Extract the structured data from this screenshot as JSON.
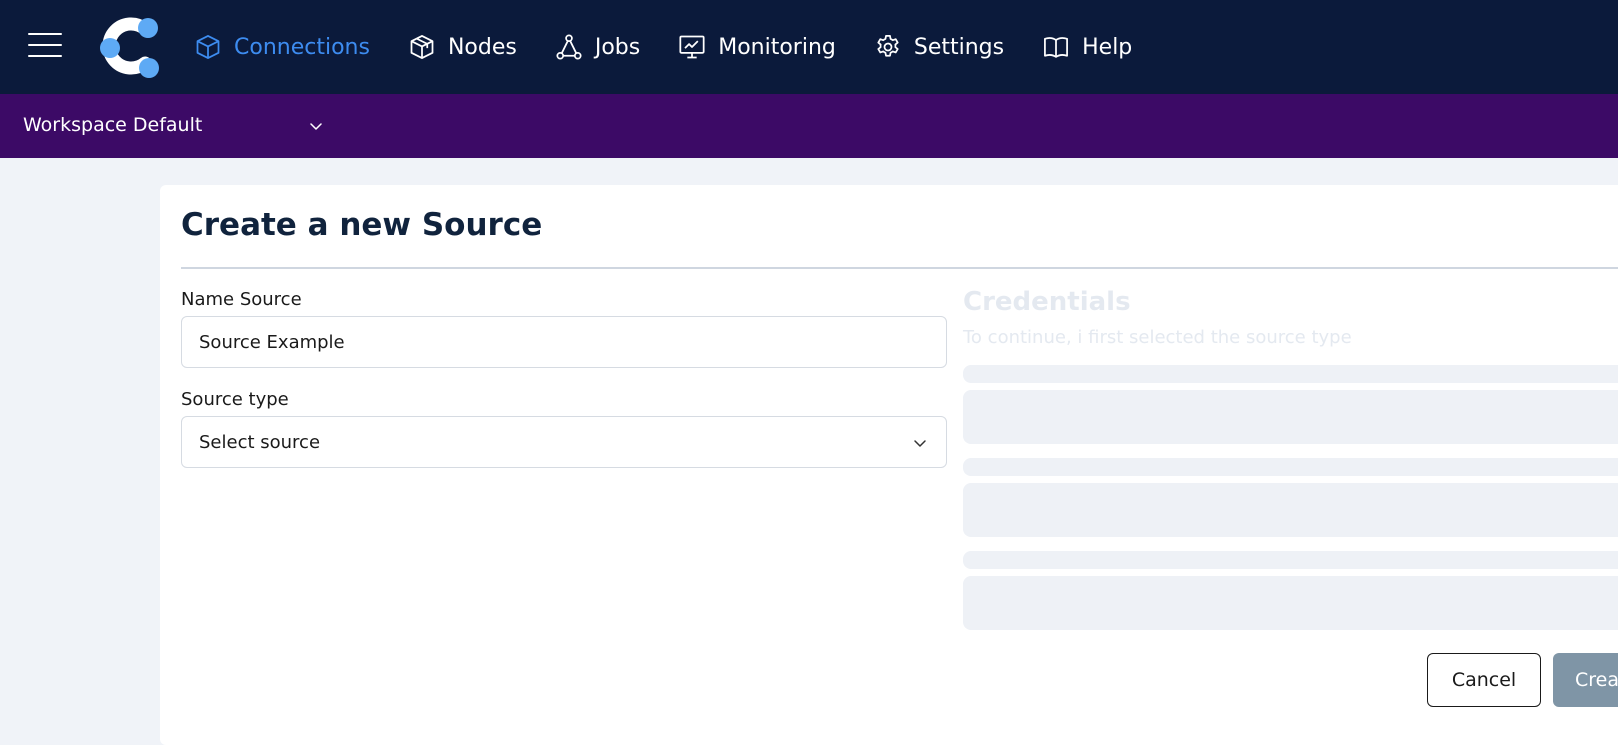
{
  "topbar": {
    "menu_icon": "hamburger-menu-icon",
    "logo_icon": "app-logo-icon",
    "nav": [
      {
        "label": "Connections",
        "icon": "cube-icon",
        "active": true
      },
      {
        "label": "Nodes",
        "icon": "boxes-icon",
        "active": false
      },
      {
        "label": "Jobs",
        "icon": "nodes-graph-icon",
        "active": false
      },
      {
        "label": "Monitoring",
        "icon": "monitor-chart-icon",
        "active": false
      },
      {
        "label": "Settings",
        "icon": "gear-icon",
        "active": false
      },
      {
        "label": "Help",
        "icon": "book-icon",
        "active": false
      }
    ]
  },
  "workspace": {
    "selected": "Workspace Default",
    "icon": "chevron-down-icon"
  },
  "form": {
    "title": "Create a new Source",
    "name_label": "Name Source",
    "name_value": "Source Example",
    "type_label": "Source type",
    "type_placeholder": "Select source",
    "credentials_title": "Credentials",
    "credentials_subtitle": "To continue, i first selected the source type",
    "cancel_label": "Cancel",
    "create_label": "Crea"
  },
  "colors": {
    "topbar_bg": "#0b1a3b",
    "workspace_bg": "#3c0a66",
    "accent": "#3d8cf0",
    "page_bg": "#f0f3f8",
    "disabled_button": "#7f95a6"
  }
}
